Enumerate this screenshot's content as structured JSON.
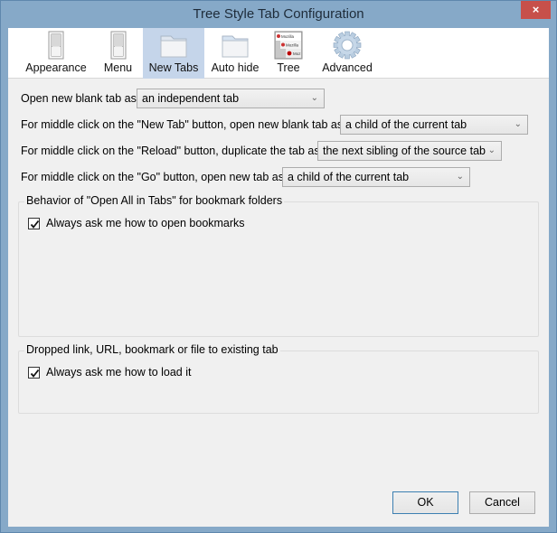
{
  "window": {
    "title": "Tree Style Tab Configuration",
    "close_label": "×"
  },
  "toolbar": {
    "items": [
      {
        "label": "Appearance",
        "icon": "switch-icon",
        "selected": false
      },
      {
        "label": "Menu",
        "icon": "switch-icon",
        "selected": false
      },
      {
        "label": "New Tabs",
        "icon": "folder-icon",
        "selected": true
      },
      {
        "label": "Auto hide",
        "icon": "folder-icon",
        "selected": false
      },
      {
        "label": "Tree",
        "icon": "tree-tabs-icon",
        "selected": false
      },
      {
        "label": "Advanced",
        "icon": "gear-icon",
        "selected": false
      }
    ],
    "tree_icon_texts": [
      "Mozilla",
      "Mozilla",
      "Moz"
    ]
  },
  "settings": {
    "rows": [
      {
        "label": "Open new blank tab as",
        "value": "an independent tab"
      },
      {
        "label": "For middle click on the \"New Tab\" button, open new blank tab as",
        "value": "a child of the current tab"
      },
      {
        "label": "For middle click on the \"Reload\" button, duplicate the tab as",
        "value": "the next sibling of the source tab"
      },
      {
        "label": "For middle click on the \"Go\" button, open new tab as",
        "value": "a child of the current tab"
      }
    ]
  },
  "groups": {
    "open_all": {
      "caption": "Behavior of \"Open All in Tabs\" for bookmark folders",
      "checkbox_label": "Always ask me how to open bookmarks",
      "checked": true
    },
    "dropped": {
      "caption": "Dropped link, URL, bookmark or file to existing tab",
      "checkbox_label": "Always ask me how to load it",
      "checked": true
    }
  },
  "buttons": {
    "ok": "OK",
    "cancel": "Cancel"
  }
}
